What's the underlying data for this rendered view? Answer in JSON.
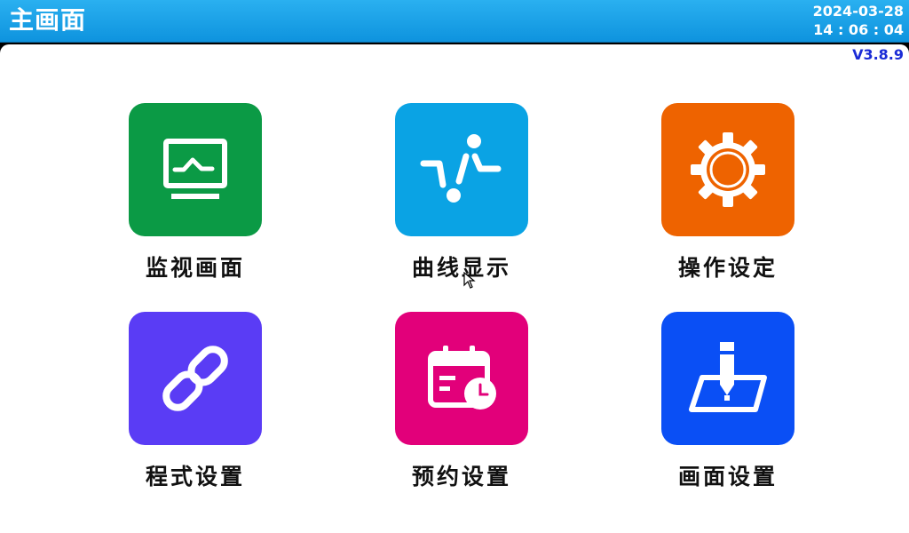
{
  "header": {
    "title": "主画面",
    "date": "2024-03-28",
    "time": "14 : 06 : 04"
  },
  "version": "V3.8.9",
  "colors": {
    "header_bg": "#169fe6",
    "monitor": "#0b9a45",
    "curve": "#0aa3e4",
    "operation": "#ee6300",
    "program": "#5a3cf5",
    "schedule": "#e2007a",
    "screen": "#0a4ff5",
    "version_text": "#1a2bd6"
  },
  "menu": [
    {
      "label": "监视画面",
      "icon": "monitor-icon"
    },
    {
      "label": "曲线显示",
      "icon": "curve-icon"
    },
    {
      "label": "操作设定",
      "icon": "gear-icon"
    },
    {
      "label": "程式设置",
      "icon": "link-icon"
    },
    {
      "label": "预约设置",
      "icon": "calendar-clock-icon"
    },
    {
      "label": "画面设置",
      "icon": "edit-icon"
    }
  ]
}
